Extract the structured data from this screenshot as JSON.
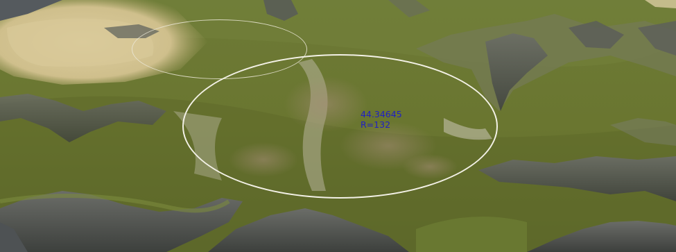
{
  "viewport": {
    "description_colors": {
      "ring": "#f3f1e6",
      "readout_text": "#1f1fc4",
      "grass": "#6b7a33",
      "rock": "#4a4d4a",
      "sand": "#d6c79a"
    }
  },
  "brush_readout": {
    "value": "44.34645",
    "radius": "R=132"
  }
}
